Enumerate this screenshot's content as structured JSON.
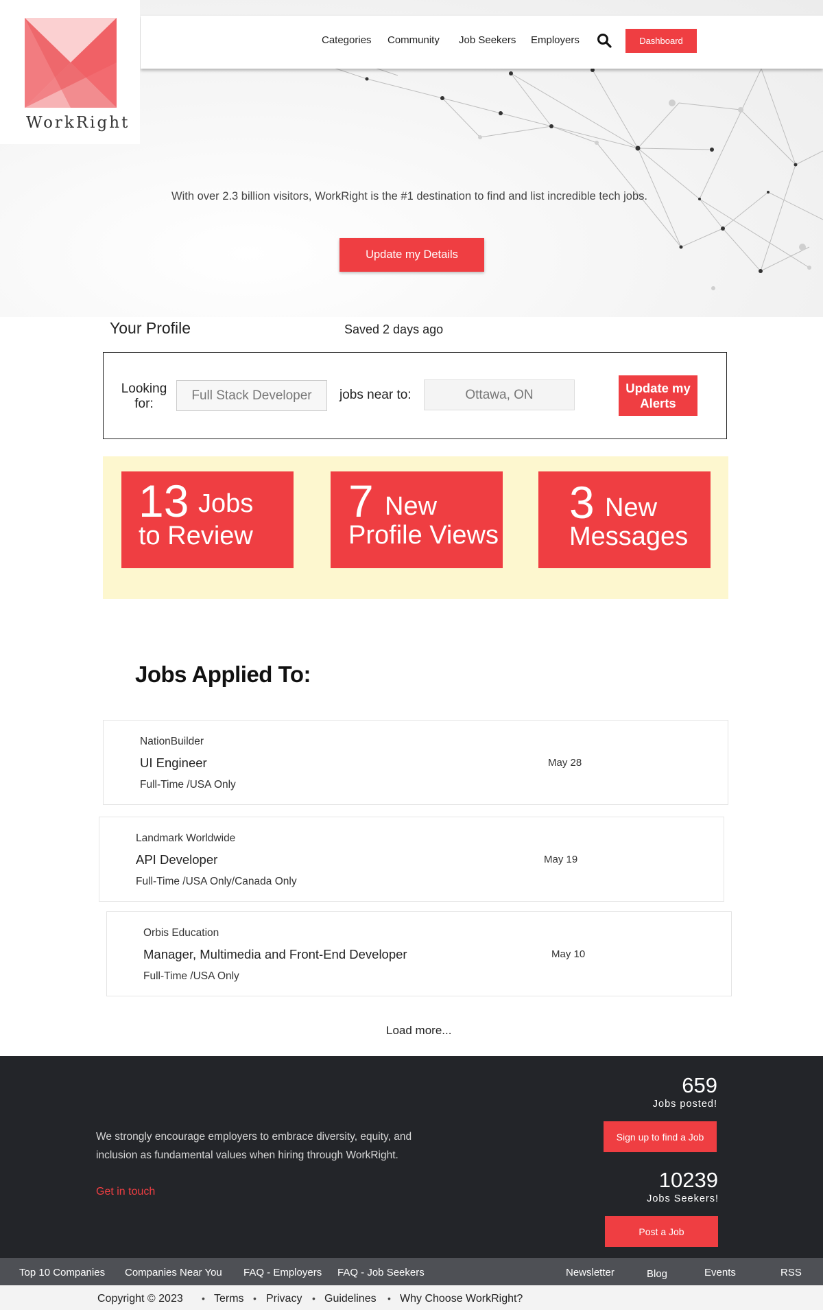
{
  "brand": {
    "name": "WorkRight",
    "accent": "#ef3e42"
  },
  "nav": {
    "items": [
      "Categories",
      "Community",
      "Job Seekers",
      "Employers"
    ],
    "search_icon": "search-icon",
    "dashboard_label": "Dashboard"
  },
  "hero": {
    "tagline": "With over 2.3 billion visitors, WorkRight is the #1 destination to find and list incredible tech jobs.",
    "button_label": "Update my Details"
  },
  "profile": {
    "title": "Your Profile",
    "saved": "Saved 2 days ago",
    "looking_label": "Looking for:",
    "role_value": "Full Stack Developer",
    "near_label": "jobs near to:",
    "location_value": "Ottawa, ON",
    "alerts_button": "Update my Alerts"
  },
  "stats": [
    {
      "number": "13",
      "word1": "Jobs",
      "word2": "to Review"
    },
    {
      "number": "7",
      "word1": "New",
      "word2": "Profile Views"
    },
    {
      "number": "3",
      "word1": "New",
      "word2": "Messages"
    }
  ],
  "jobs": {
    "heading": "Jobs Applied To:",
    "items": [
      {
        "company": "NationBuilder",
        "title": "UI Engineer",
        "meta": "Full-Time /USA Only",
        "date": "May 28"
      },
      {
        "company": "Landmark Worldwide",
        "title": "API Developer",
        "meta": "Full-Time /USA Only/Canada Only",
        "date": "May 19"
      },
      {
        "company": "Orbis Education",
        "title": "Manager, Multimedia and Front-End Developer",
        "meta": "Full-Time /USA Only",
        "date": "May 10"
      }
    ],
    "load_more": "Load more..."
  },
  "footer": {
    "text": "We strongly encourage employers to embrace diversity, equity, and inclusion as fundamental values when hiring through WorkRight.",
    "get_in_touch": "Get in touch",
    "jobs_posted_num": "659",
    "jobs_posted_label": "Jobs posted!",
    "signup_button": "Sign up to find a Job",
    "seekers_num": "10239",
    "seekers_label": "Jobs Seekers!",
    "post_button": "Post a Job"
  },
  "link_bar": {
    "left": [
      "Top 10 Companies",
      "Companies Near You",
      "FAQ - Employers",
      "FAQ - Job Seekers"
    ],
    "right": [
      "Newsletter",
      "Blog",
      "Events",
      "RSS"
    ]
  },
  "bottom": {
    "copyright": "Copyright © 2023",
    "links": [
      "Terms",
      "Privacy",
      "Guidelines",
      "Why Choose WorkRight?"
    ]
  }
}
